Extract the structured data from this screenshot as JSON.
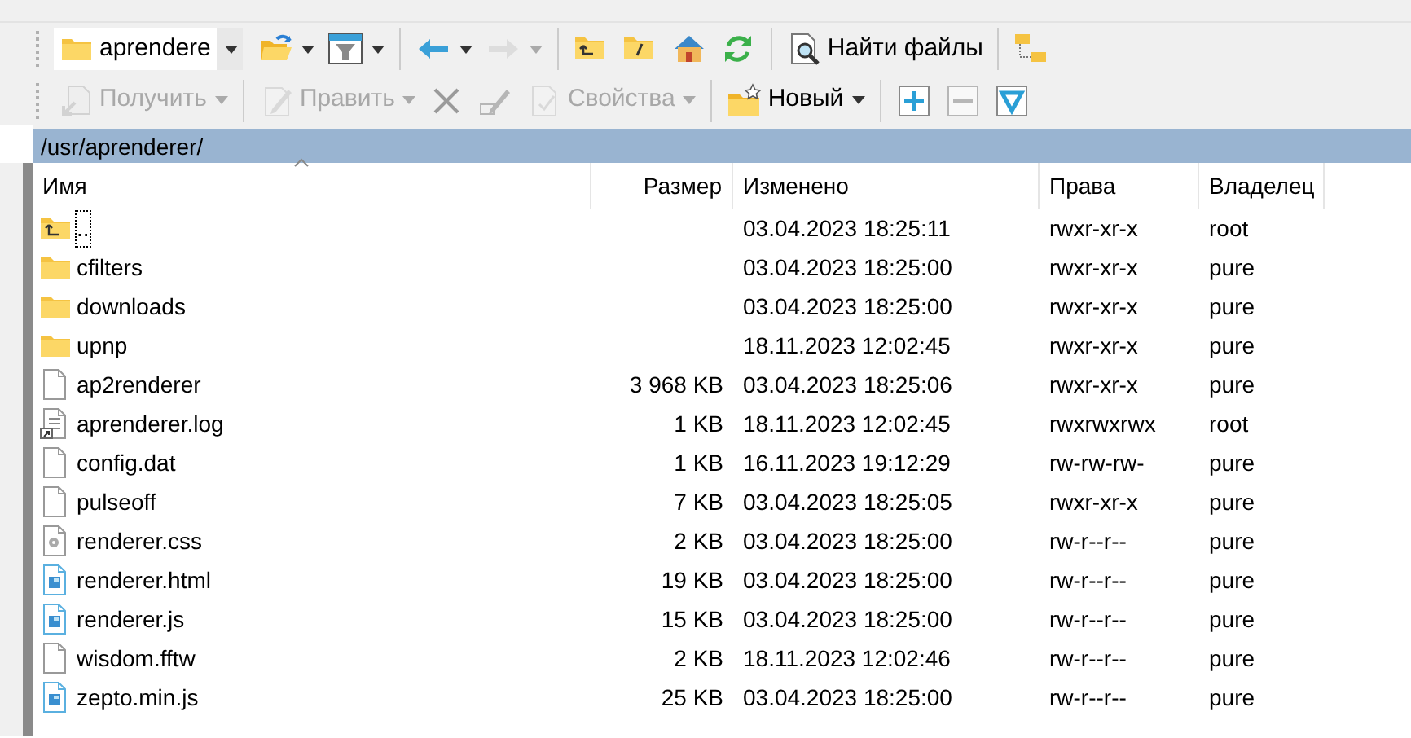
{
  "toolbar_top": [
    {
      "kind": "combo",
      "value": "aprendere"
    },
    {
      "kind": "icon",
      "has_menu": true,
      "disabled": false
    },
    {
      "kind": "icon",
      "has_menu": true,
      "disabled": false
    },
    {
      "kind": "sep"
    },
    {
      "kind": "icon",
      "has_menu": true,
      "disabled": false
    },
    {
      "kind": "icon",
      "has_menu": true,
      "disabled": true
    },
    {
      "kind": "sep"
    },
    {
      "kind": "icon",
      "has_menu": false,
      "disabled": false
    },
    {
      "kind": "icon",
      "has_menu": false,
      "disabled": false
    },
    {
      "kind": "icon",
      "has_menu": false,
      "disabled": false
    },
    {
      "kind": "icon",
      "has_menu": false,
      "disabled": false
    },
    {
      "kind": "sep"
    },
    {
      "kind": "text",
      "label": "Найти файлы",
      "has_menu": false,
      "disabled": false
    },
    {
      "kind": "sep"
    },
    {
      "kind": "icon",
      "has_menu": false,
      "disabled": false
    }
  ],
  "toolbar_bottom": [
    {
      "kind": "text",
      "label": "Получить",
      "has_menu": true,
      "disabled": true
    },
    {
      "kind": "sep"
    },
    {
      "kind": "text",
      "label": "Править",
      "has_menu": true,
      "disabled": true
    },
    {
      "kind": "icon",
      "has_menu": false,
      "disabled": true
    },
    {
      "kind": "icon",
      "has_menu": false,
      "disabled": true
    },
    {
      "kind": "text",
      "label": "Свойства",
      "has_menu": true,
      "disabled": true
    },
    {
      "kind": "sep"
    },
    {
      "kind": "text",
      "label": "Новый",
      "has_menu": true,
      "disabled": false
    },
    {
      "kind": "sep"
    },
    {
      "kind": "icon",
      "has_menu": false,
      "disabled": false
    },
    {
      "kind": "icon",
      "has_menu": false,
      "disabled": true
    },
    {
      "kind": "icon",
      "has_menu": false,
      "disabled": false
    }
  ],
  "path_bar": {
    "path": "/usr/aprenderer/"
  },
  "table": {
    "columns": [
      {
        "label": "Имя",
        "sorted": true
      },
      {
        "label": "Размер",
        "sorted": false
      },
      {
        "label": "Изменено",
        "sorted": false
      },
      {
        "label": "Права",
        "sorted": false
      },
      {
        "label": "Владелец",
        "sorted": false
      }
    ],
    "rows": [
      {
        "kind": "up",
        "name": "..",
        "size": "",
        "modified": "03.04.2023 18:25:11",
        "rights": "rwxr-xr-x",
        "owner": "root",
        "focused": true
      },
      {
        "kind": "folder",
        "name": "cfilters",
        "size": "",
        "modified": "03.04.2023 18:25:00",
        "rights": "rwxr-xr-x",
        "owner": "pure",
        "focused": false
      },
      {
        "kind": "folder",
        "name": "downloads",
        "size": "",
        "modified": "03.04.2023 18:25:00",
        "rights": "rwxr-xr-x",
        "owner": "pure",
        "focused": false
      },
      {
        "kind": "folder",
        "name": "upnp",
        "size": "",
        "modified": "18.11.2023 12:02:45",
        "rights": "rwxr-xr-x",
        "owner": "pure",
        "focused": false
      },
      {
        "kind": "file",
        "name": "ap2renderer",
        "size": "3 968 KB",
        "modified": "03.04.2023 18:25:06",
        "rights": "rwxr-xr-x",
        "owner": "pure",
        "focused": false
      },
      {
        "kind": "link",
        "name": "aprenderer.log",
        "size": "1 KB",
        "modified": "18.11.2023 12:02:45",
        "rights": "rwxrwxrwx",
        "owner": "root",
        "focused": false
      },
      {
        "kind": "file",
        "name": "config.dat",
        "size": "1 KB",
        "modified": "16.11.2023 19:12:29",
        "rights": "rw-rw-rw-",
        "owner": "pure",
        "focused": false
      },
      {
        "kind": "file",
        "name": "pulseoff",
        "size": "7 KB",
        "modified": "03.04.2023 18:25:05",
        "rights": "rwxr-xr-x",
        "owner": "pure",
        "focused": false
      },
      {
        "kind": "settings",
        "name": "renderer.css",
        "size": "2 KB",
        "modified": "03.04.2023 18:25:00",
        "rights": "rw-r--r--",
        "owner": "pure",
        "focused": false
      },
      {
        "kind": "web",
        "name": "renderer.html",
        "size": "19 KB",
        "modified": "03.04.2023 18:25:00",
        "rights": "rw-r--r--",
        "owner": "pure",
        "focused": false
      },
      {
        "kind": "web",
        "name": "renderer.js",
        "size": "15 KB",
        "modified": "03.04.2023 18:25:00",
        "rights": "rw-r--r--",
        "owner": "pure",
        "focused": false
      },
      {
        "kind": "file",
        "name": "wisdom.fftw",
        "size": "2 KB",
        "modified": "18.11.2023 12:02:46",
        "rights": "rw-r--r--",
        "owner": "pure",
        "focused": false
      },
      {
        "kind": "web",
        "name": "zepto.min.js",
        "size": "25 KB",
        "modified": "03.04.2023 18:25:00",
        "rights": "rw-r--r--",
        "owner": "pure",
        "focused": false
      }
    ]
  }
}
